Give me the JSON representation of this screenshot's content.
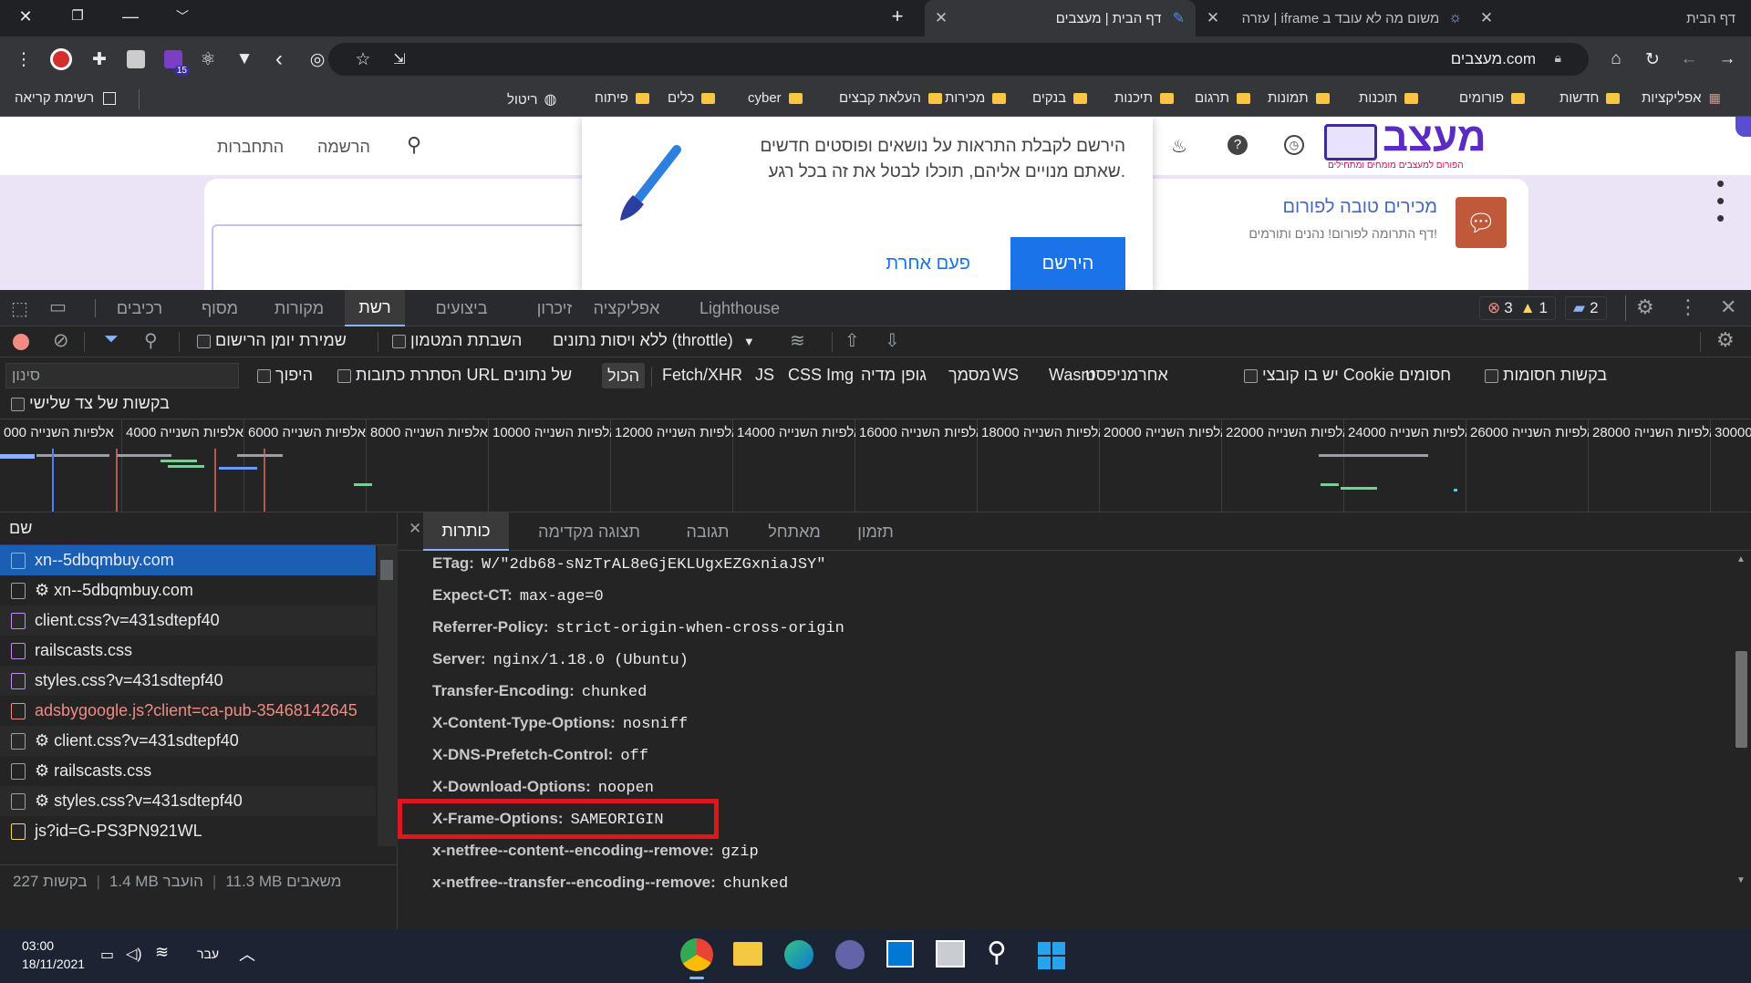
{
  "tabs": [
    {
      "title": "דף הבית",
      "active": false
    },
    {
      "title": "עזרה | iframe משום מה לא עובד ב",
      "active": false
    },
    {
      "title": "דף הבית | מעצבים",
      "active": true
    }
  ],
  "toolbar": {
    "url": "מעצבים.com",
    "extension_badge": "15"
  },
  "bookmarks": {
    "apps": "אפליקציות",
    "folders": [
      "חדשות",
      "פורומים",
      "תוכנות",
      "תמונות",
      "תרגום",
      "תיכנות",
      "בנקים",
      "מכירות",
      "העלאת קבצים",
      "cyber",
      "כלים",
      "פיתוח"
    ],
    "ritual": "ריטול",
    "reading_list": "רשימת קריאה"
  },
  "page": {
    "nav": {
      "login": "התחברות",
      "register": "הרשמה"
    },
    "popup": {
      "text_line1": "הירשם לקבלת התראות על נושאים ופוסטים חדשים",
      "text_line2": "שאתם מנויים אליהם, תוכלו לבטל את זה בכל רגע.",
      "subscribe": "הירשם",
      "later": "פעם אחרת"
    },
    "welcome": {
      "title": "מכירים טובה לפורום",
      "subtitle": "דף התרומה לפורום! נהנים ותורמים!"
    },
    "logo": {
      "text": "מעצב",
      "tagline": "הפורום למעצבים מומחים ומתחילים"
    }
  },
  "devtools": {
    "tabs": [
      "רכיבים",
      "מסוף",
      "מקורות",
      "רשת",
      "ביצועים",
      "זיכרון",
      "אפליקציה",
      "Lighthouse"
    ],
    "active_tab": "רשת",
    "errors": "3",
    "warnings": "1",
    "messages": "2",
    "network_toolbar": {
      "preserve_log": "שמירת יומן הרישום",
      "disable_cache": "השבתת המטמון",
      "throttle": "ללא ויסות נתונים (throttle)"
    },
    "filter": {
      "placeholder": "סינון",
      "invert": "היפוך",
      "hide_data_urls": "הסתרת כתובות URL של נתונים",
      "all": "הכול",
      "types": [
        "Fetch/XHR",
        "JS",
        "CSS",
        "Img",
        "מדיה",
        "גופן",
        "מסמך",
        "WS",
        "Wasm",
        "מניפסט",
        "אחר"
      ],
      "blocked_cookies": "יש בו קובצי Cookie חסומים",
      "blocked_requests": "בקשות חסומות",
      "third_party": "בקשות של צד שלישי"
    },
    "timeline_ticks": [
      "000",
      "4000",
      "6000",
      "8000",
      "10000",
      "12000",
      "14000",
      "16000",
      "18000",
      "20000",
      "22000",
      "24000",
      "26000",
      "28000",
      "30000"
    ],
    "timeline_unit": "אלפיות השנייה",
    "name_header": "שם",
    "requests": [
      {
        "name": "xn--5dbqmbuy.com",
        "selected": true,
        "error": false
      },
      {
        "name": "⚙ xn--5dbqmbuy.com",
        "selected": false,
        "error": false
      },
      {
        "name": "client.css?v=431sdtepf40",
        "selected": false,
        "error": false
      },
      {
        "name": "railscasts.css",
        "selected": false,
        "error": false
      },
      {
        "name": "styles.css?v=431sdtepf40",
        "selected": false,
        "error": false
      },
      {
        "name": "adsbygoogle.js?client=ca-pub-35468142645",
        "selected": false,
        "error": true
      },
      {
        "name": "⚙ client.css?v=431sdtepf40",
        "selected": false,
        "error": false
      },
      {
        "name": "⚙ railscasts.css",
        "selected": false,
        "error": false
      },
      {
        "name": "⚙ styles.css?v=431sdtepf40",
        "selected": false,
        "error": false
      },
      {
        "name": "js?id=G-PS3PN921WL",
        "selected": false,
        "error": false
      }
    ],
    "summary": {
      "requests": "227 בקשות",
      "transferred": "1.4 MB הועבר",
      "resources": "11.3 MB משאבים"
    },
    "detail_tabs": [
      "כותרות",
      "תצוגה מקדימה",
      "תגובה",
      "מאתחל",
      "תזמון"
    ],
    "headers": [
      {
        "key": "ETag:",
        "value": "W/\"2db68-sNzTrAL8eGjEKLUgxEZGxniaJSY\""
      },
      {
        "key": "Expect-CT:",
        "value": "max-age=0"
      },
      {
        "key": "Referrer-Policy:",
        "value": "strict-origin-when-cross-origin"
      },
      {
        "key": "Server:",
        "value": "nginx/1.18.0 (Ubuntu)"
      },
      {
        "key": "Transfer-Encoding:",
        "value": "chunked"
      },
      {
        "key": "X-Content-Type-Options:",
        "value": "nosniff"
      },
      {
        "key": "X-DNS-Prefetch-Control:",
        "value": "off"
      },
      {
        "key": "X-Download-Options:",
        "value": "noopen"
      },
      {
        "key": "X-Frame-Options:",
        "value": "SAMEORIGIN"
      },
      {
        "key": "x-netfree--content--encoding--remove:",
        "value": "gzip"
      },
      {
        "key": "x-netfree--transfer--encoding--remove:",
        "value": "chunked"
      }
    ],
    "highlight_color": "#e0161d"
  },
  "taskbar": {
    "time": "03:00",
    "date": "18/11/2021",
    "lang": "עבר"
  }
}
